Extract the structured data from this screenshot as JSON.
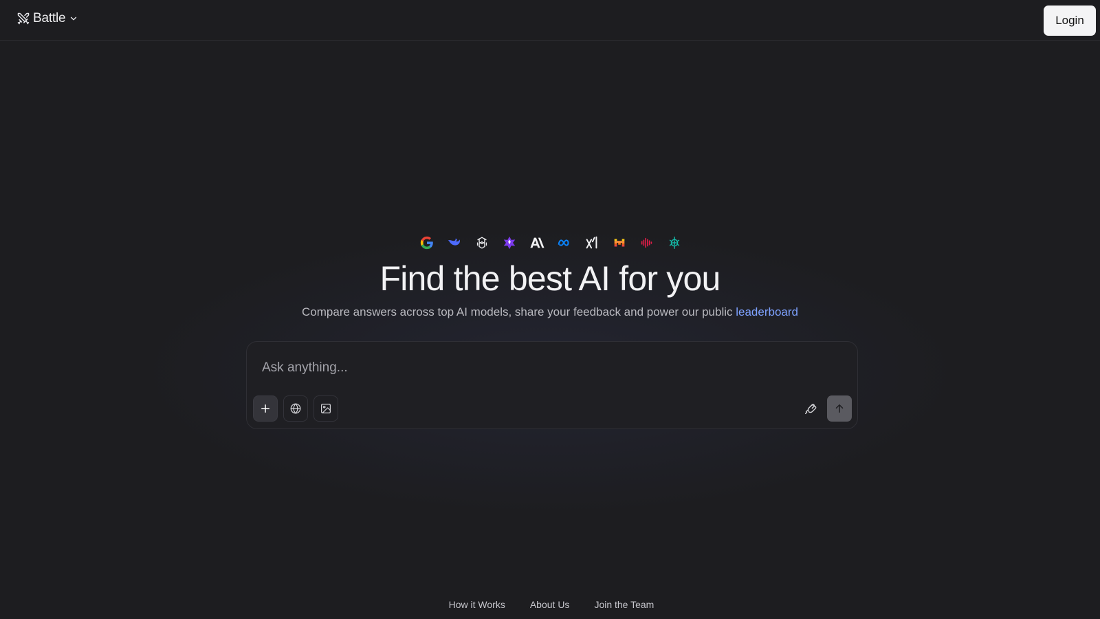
{
  "header": {
    "brand_label": "Battle",
    "brand_icon": "crossed-swords-icon",
    "menu_icon": "chevron-down-icon",
    "login_label": "Login"
  },
  "model_logos": [
    {
      "name": "google-logo-icon",
      "color": "#4285f4"
    },
    {
      "name": "deepseek-logo-icon",
      "color": "#4d6bfe"
    },
    {
      "name": "openai-logo-icon",
      "color": "#e8e8ea"
    },
    {
      "name": "perplexity-star-logo-icon",
      "color": "#8b5cf6"
    },
    {
      "name": "anthropic-logo-icon",
      "color": "#f2f2f4"
    },
    {
      "name": "meta-logo-icon",
      "color": "#0a84ff"
    },
    {
      "name": "xai-logo-icon",
      "color": "#f2f2f4"
    },
    {
      "name": "mistral-logo-icon",
      "color": "#f97316"
    },
    {
      "name": "audio-wave-logo-icon",
      "color": "#e11d48"
    },
    {
      "name": "teal-logo-icon",
      "color": "#14b8a6"
    }
  ],
  "hero": {
    "title": "Find the best AI for you",
    "subtitle": "Compare answers across top AI models, share your feedback and power our public ",
    "subtitle_link": "leaderboard",
    "link_color": "#7ea2ff"
  },
  "prompt": {
    "placeholder": "Ask anything...",
    "value": "",
    "tools": [
      "plus-icon",
      "globe-icon",
      "image-icon"
    ],
    "hand_icon": "hand-icon",
    "send_icon": "arrow-up-icon"
  },
  "footer": {
    "links": [
      "How it Works",
      "About Us",
      "Join the Team"
    ]
  }
}
